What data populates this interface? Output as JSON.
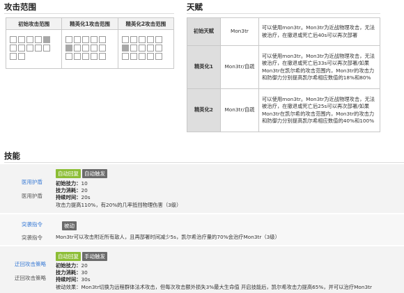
{
  "attack_range": {
    "title": "攻击范围",
    "headers": [
      "初始攻击范围",
      "精英化1攻击范围",
      "精英化2攻击范围"
    ]
  },
  "talent": {
    "title": "天赋",
    "rows": [
      {
        "label": "初始天赋",
        "cond": "Mon3tr",
        "desc": "可以使用mon3tr。Mon3tr为近战物理攻击，无法被治疗，在撤退或死亡后40s可以再次部署"
      },
      {
        "label": "精英化1",
        "cond": "Mon3tr/自疏",
        "desc": "可以使用mon3tr。Mon3tr为近战物理攻击，无法被治疗，在撤退或死亡后33s可以再次部署/如果Mon3tr在凯尔希的攻击范围内，Mon3tr的攻击力和防御力分别提高凯尔希相应数值的18%和80%"
      },
      {
        "label": "精英化2",
        "cond": "Mon3tr/自疏",
        "desc": "可以使用mon3tr。Mon3tr为近战物理攻击，无法被治疗，在撤退或死亡后25s可以再次部署/如果Mon3tr在凯尔希的攻击范围内，Mon3tr的攻击力和防御力分别提高凯尔希相应数值的40%和100%"
      }
    ]
  },
  "skills": {
    "title": "技能",
    "items": [
      {
        "link": "医用护盾",
        "name": "医用护盾",
        "tags": [
          "自动回复",
          "自动触发"
        ],
        "stats": [
          {
            "k": "初始技力：",
            "v": "10"
          },
          {
            "k": "技力消耗：",
            "v": "20"
          },
          {
            "k": "持续时间：",
            "v": "20s"
          }
        ],
        "desc": "攻击力提高110%，有20%的几率抵挡物理伤害（3级）"
      },
      {
        "link": "突袭指令",
        "name": "突袭指令",
        "tags": [
          "被动"
        ],
        "desc": "Mon3tr可以攻击附近所有敌人，且再部署时间减少5s，凯尔希治疗量的70%会治疗Mon3tr（3级）"
      },
      {
        "link": "迂回攻击策略",
        "name": "迂回攻击策略",
        "tags": [
          "自动回复",
          "手动触发"
        ],
        "stats": [
          {
            "k": "初始技力：",
            "v": "20"
          },
          {
            "k": "技力消耗：",
            "v": "30"
          },
          {
            "k": "持续时间：",
            "v": "30s"
          }
        ],
        "desc": "被动效果：Mon3tr切换为远程群体法术攻击，但每次攻击额外损失3%最大生命值 开启技能后，凯尔希攻击力提高65%，并可以治疗Mon3tr"
      }
    ]
  },
  "colors": {
    "green_tag": "#8cbd35",
    "gray_tag": "#6b6b6b",
    "link": "#3a7bd5"
  }
}
